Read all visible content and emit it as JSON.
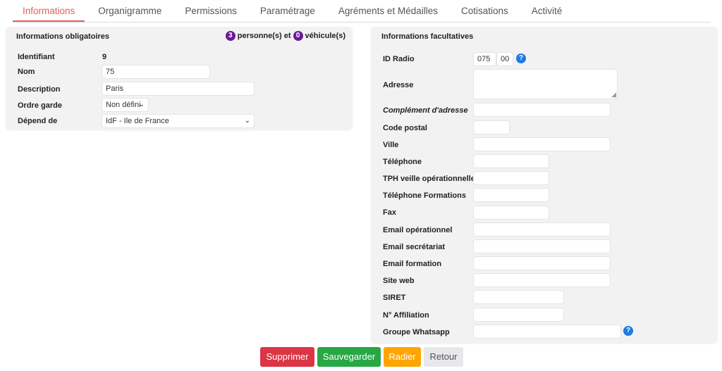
{
  "tabs": [
    {
      "label": "Informations"
    },
    {
      "label": "Organigramme"
    },
    {
      "label": "Permissions"
    },
    {
      "label": "Paramétrage"
    },
    {
      "label": "Agréments et Médailles"
    },
    {
      "label": "Cotisations"
    },
    {
      "label": "Activité"
    }
  ],
  "left": {
    "title": "Informations obligatoires",
    "persons_count": "3",
    "persons_label": "personne(s) et",
    "vehicles_count": "0",
    "vehicles_label": "véhicule(s)",
    "fields": {
      "identifiant": {
        "label": "Identifiant",
        "value": "9"
      },
      "nom": {
        "label": "Nom",
        "value": "75"
      },
      "description": {
        "label": "Description",
        "value": "Paris"
      },
      "ordre_garde": {
        "label": "Ordre garde",
        "value": "Non défini"
      },
      "depend_de": {
        "label": "Dépend de",
        "value": "IdF - Ile de France"
      }
    }
  },
  "right": {
    "title": "Informations facultatives",
    "id_radio": {
      "label": "ID Radio",
      "value1": "075",
      "value2": "00"
    },
    "adresse": {
      "label": "Adresse",
      "value": ""
    },
    "complement": {
      "label": "Complément d'adresse",
      "value": ""
    },
    "code_postal": {
      "label": "Code postal",
      "value": ""
    },
    "ville": {
      "label": "Ville",
      "value": ""
    },
    "telephone": {
      "label": "Téléphone",
      "value": ""
    },
    "tph_veille": {
      "label": "TPH veille opérationnelle",
      "value": ""
    },
    "tel_formations": {
      "label": "Téléphone Formations",
      "value": ""
    },
    "fax": {
      "label": "Fax",
      "value": ""
    },
    "email_op": {
      "label": "Email opérationnel",
      "value": ""
    },
    "email_secr": {
      "label": "Email secrétariat",
      "value": ""
    },
    "email_form": {
      "label": "Email formation",
      "value": ""
    },
    "site_web": {
      "label": "Site web",
      "value": ""
    },
    "siret": {
      "label": "SIRET",
      "value": ""
    },
    "affiliation": {
      "label": "N° Affiliation",
      "value": ""
    },
    "whatsapp": {
      "label": "Groupe Whatsapp",
      "value": ""
    }
  },
  "buttons": {
    "delete": "Supprimer",
    "save": "Sauvegarder",
    "radier": "Radier",
    "back": "Retour"
  },
  "colors": {
    "active_tab": "#e0605a",
    "badge": "#6a1b9a",
    "help": "#1e7be0",
    "delete": "#dc3545",
    "save": "#28a745",
    "radier": "#ffa500",
    "back": "#e8e8ea"
  }
}
